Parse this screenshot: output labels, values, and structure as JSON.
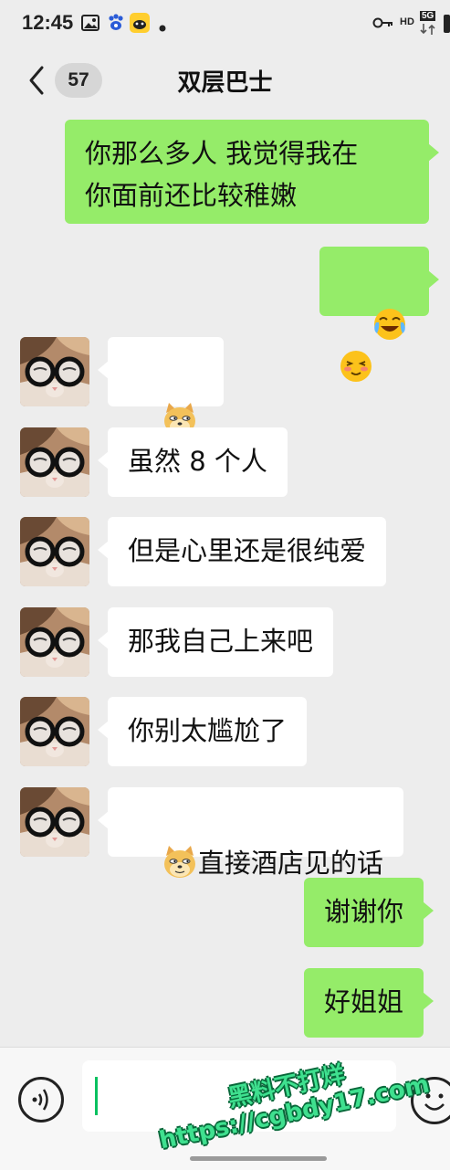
{
  "status_bar": {
    "time": "12:45",
    "network": "5G",
    "hd_label": "HD"
  },
  "nav": {
    "unread_count": "57",
    "title": "双层巴士"
  },
  "messages": [
    {
      "side": "out",
      "text": "你那么多人 我觉得我在\n你面前还比较稚嫩"
    },
    {
      "side": "out",
      "emojis": [
        "crying-laughing-emoji",
        "blushing-emoji"
      ]
    },
    {
      "side": "in",
      "emojis": [
        "doge-emoji",
        "doge-emoji"
      ]
    },
    {
      "side": "in",
      "text": "虽然 8 个人"
    },
    {
      "side": "in",
      "text": "但是心里还是很纯爱"
    },
    {
      "side": "in",
      "text": "那我自己上来吧"
    },
    {
      "side": "in",
      "text": "你别太尴尬了"
    },
    {
      "side": "in",
      "emoji": "doge-emoji",
      "text": "直接酒店见的话"
    },
    {
      "side": "out",
      "text": "谢谢你"
    },
    {
      "side": "out",
      "text": "好姐姐"
    }
  ],
  "watermark": {
    "line1": "黑料不打烊",
    "line2": "https://cgbdy17.com"
  },
  "colors": {
    "background": "#ededed",
    "outgoing_bubble": "#95ec69",
    "incoming_bubble": "#ffffff",
    "caret": "#07c160"
  }
}
